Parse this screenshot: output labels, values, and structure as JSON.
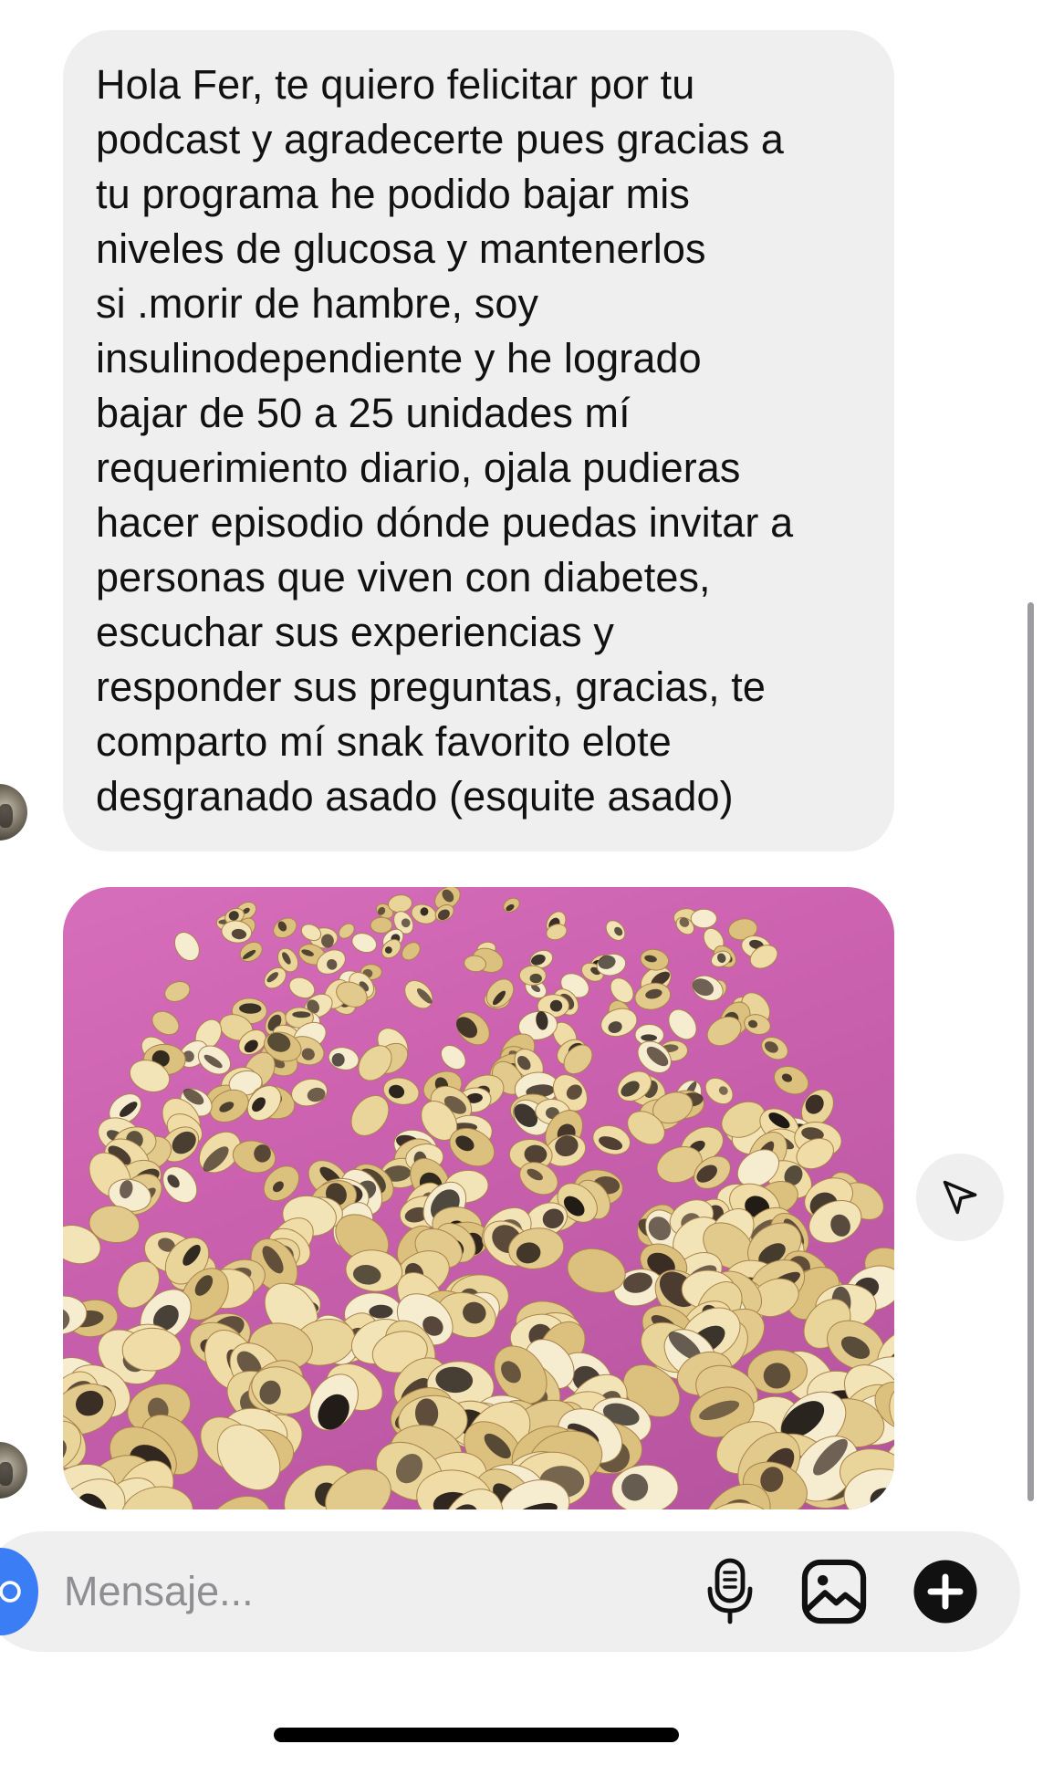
{
  "conversation": {
    "message": {
      "text": "Hola Fer, te quiero felicitar por tu\npodcast y agradecerte pues gracias a\ntu programa he podido bajar mis\nniveles de glucosa y mantenerlos\nsi .morir de hambre, soy\ninsulinodependiente y he logrado\nbajar de 50 a 25 unidades mí\nrequerimiento diario, ojala pudieras\nhacer episodio dónde puedas invitar a\npersonas que viven con diabetes,\nescuchar sus experiencias y\nresponder sus preguntas, gracias, te\ncomparto mí snak favorito  elote\ndesgranado asado (esquite asado)"
    },
    "photo": {
      "subject": "roasted corn kernels on pink plate",
      "plate_color": "#c65aa8"
    },
    "share_icon": "paper-plane-icon"
  },
  "composer": {
    "placeholder": "Mensaje...",
    "value": "",
    "icons": {
      "camera": "camera-icon",
      "mic": "microphone-icon",
      "gallery": "image-gallery-icon",
      "add": "plus-circle-icon"
    },
    "accent_color": "#3a7df5"
  }
}
